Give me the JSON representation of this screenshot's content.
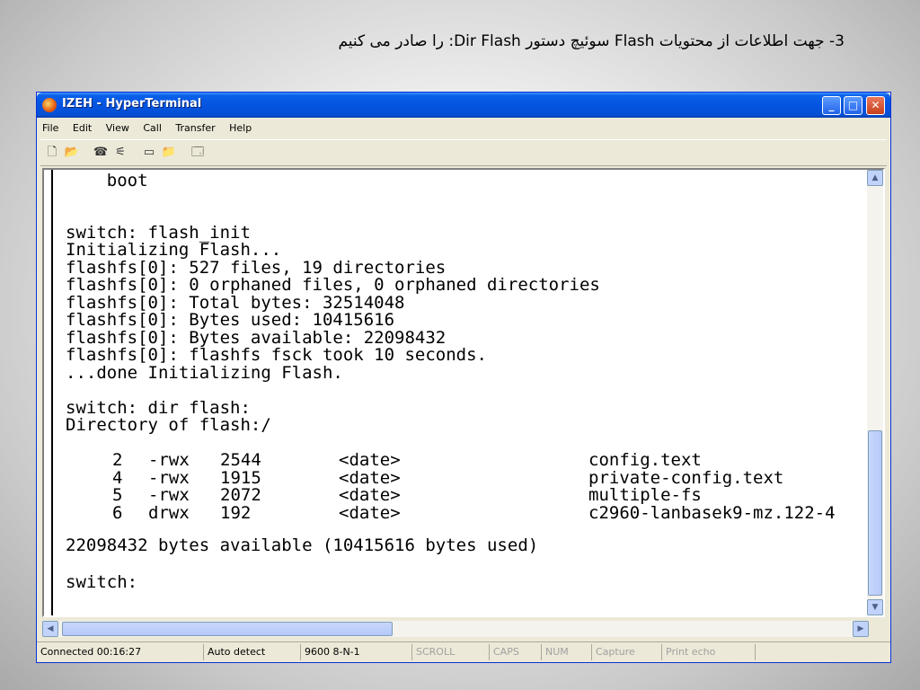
{
  "slide": {
    "title": "3- جهت اطلاعات از محتویات Flash سوئیچ دستور Dir Flash: را صادر می کنیم"
  },
  "window": {
    "title": "IZEH - HyperTerminal",
    "controls": {
      "minimize": "_",
      "maximize": "□",
      "close": "✕"
    }
  },
  "menu": [
    "File",
    "Edit",
    "View",
    "Call",
    "Transfer",
    "Help"
  ],
  "toolbar_icons": [
    "new-document-icon",
    "open-folder-icon",
    "connect-phone-icon",
    "disconnect-icon",
    "send-icon",
    "receive-icon",
    "properties-icon"
  ],
  "terminal": {
    "lines": [
      "    boot",
      "",
      "",
      "switch: flash_init",
      "Initializing Flash...",
      "flashfs[0]: 527 files, 19 directories",
      "flashfs[0]: 0 orphaned files, 0 orphaned directories",
      "flashfs[0]: Total bytes: 32514048",
      "flashfs[0]: Bytes used: 10415616",
      "flashfs[0]: Bytes available: 22098432",
      "flashfs[0]: flashfs fsck took 10 seconds.",
      "...done Initializing Flash.",
      "",
      "switch: dir flash:",
      "Directory of flash:/"
    ],
    "directory": [
      {
        "index": "2",
        "perms": "-rwx",
        "size": "2544",
        "date": "<date>",
        "name": "config.text"
      },
      {
        "index": "4",
        "perms": "-rwx",
        "size": "1915",
        "date": "<date>",
        "name": "private-config.text"
      },
      {
        "index": "5",
        "perms": "-rwx",
        "size": "2072",
        "date": "<date>",
        "name": "multiple-fs"
      },
      {
        "index": "6",
        "perms": "drwx",
        "size": "192",
        "date": "<date>",
        "name": "c2960-lanbasek9-mz.122-4"
      }
    ],
    "summary": "22098432 bytes available (10415616 bytes used)",
    "prompt": "switch:"
  },
  "status": {
    "connected": "Connected 00:16:27",
    "detect": "Auto detect",
    "settings": "9600 8-N-1",
    "scroll": "SCROLL",
    "caps": "CAPS",
    "num": "NUM",
    "capture": "Capture",
    "print_echo": "Print echo"
  },
  "colors": {
    "titlebar": "#0454e2",
    "chrome": "#ece9d8",
    "terminal_bg": "#ffffff"
  }
}
